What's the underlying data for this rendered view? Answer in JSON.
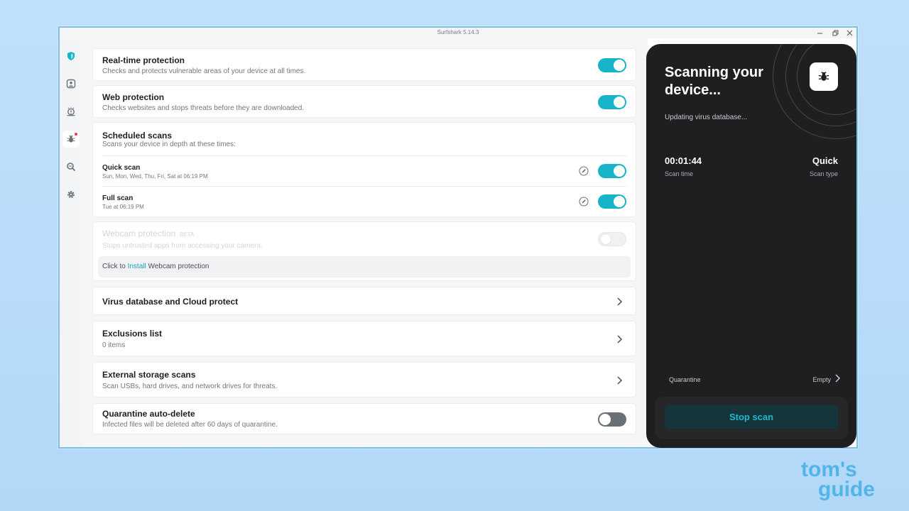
{
  "window": {
    "title": "Surfshark 5.14.3"
  },
  "sidebar": {
    "items": [
      {
        "icon": "shield-icon"
      },
      {
        "icon": "person-icon"
      },
      {
        "icon": "alert-icon"
      },
      {
        "icon": "bug-icon",
        "active": true,
        "badge": true
      },
      {
        "icon": "search-icon"
      },
      {
        "icon": "gear-icon"
      }
    ]
  },
  "settings": {
    "realtime": {
      "title": "Real-time protection",
      "subtitle": "Checks and protects vulnerable areas of your device at all times.",
      "enabled": true
    },
    "web": {
      "title": "Web protection",
      "subtitle": "Checks websites and stops threats before they are downloaded.",
      "enabled": true
    },
    "scheduled": {
      "title": "Scheduled scans",
      "subtitle": "Scans your device in depth at these times:",
      "quick": {
        "title": "Quick scan",
        "schedule": "Sun, Mon, Wed, Thu, Fri, Sat at 06:19 PM",
        "enabled": true
      },
      "full": {
        "title": "Full scan",
        "schedule": "Tue at 06:19 PM",
        "enabled": true
      }
    },
    "webcam": {
      "title": "Webcam protection",
      "badge": "BETA",
      "subtitle": "Stops untrusted apps from accessing your camera.",
      "install_prefix": "Click to",
      "install_link": "Install",
      "install_suffix": "Webcam protection",
      "enabled": false
    },
    "virus_db": {
      "title": "Virus database and Cloud protect"
    },
    "exclusions": {
      "title": "Exclusions list",
      "subtitle": "0 items"
    },
    "external": {
      "title": "External storage scans",
      "subtitle": "Scan USBs, hard drives, and network drives for threats."
    },
    "quarantine_delete": {
      "title": "Quarantine auto-delete",
      "subtitle": "Infected files will be deleted after 60 days of quarantine.",
      "enabled": false
    }
  },
  "scan_panel": {
    "heading": "Scanning your device...",
    "status": "Updating virus database...",
    "scan_time": {
      "value": "00:01:44",
      "label": "Scan time"
    },
    "scan_type": {
      "value": "Quick",
      "label": "Scan type"
    },
    "quarantine": {
      "label": "Quarantine",
      "value": "Empty"
    },
    "stop_button": "Stop scan"
  },
  "watermark": {
    "line1": "tom's",
    "line2": "guide"
  },
  "colors": {
    "accent": "#17b3c8",
    "panel_bg": "#1e1f21",
    "stop_text": "#1fb8cf",
    "badge_red": "#f03a47"
  }
}
